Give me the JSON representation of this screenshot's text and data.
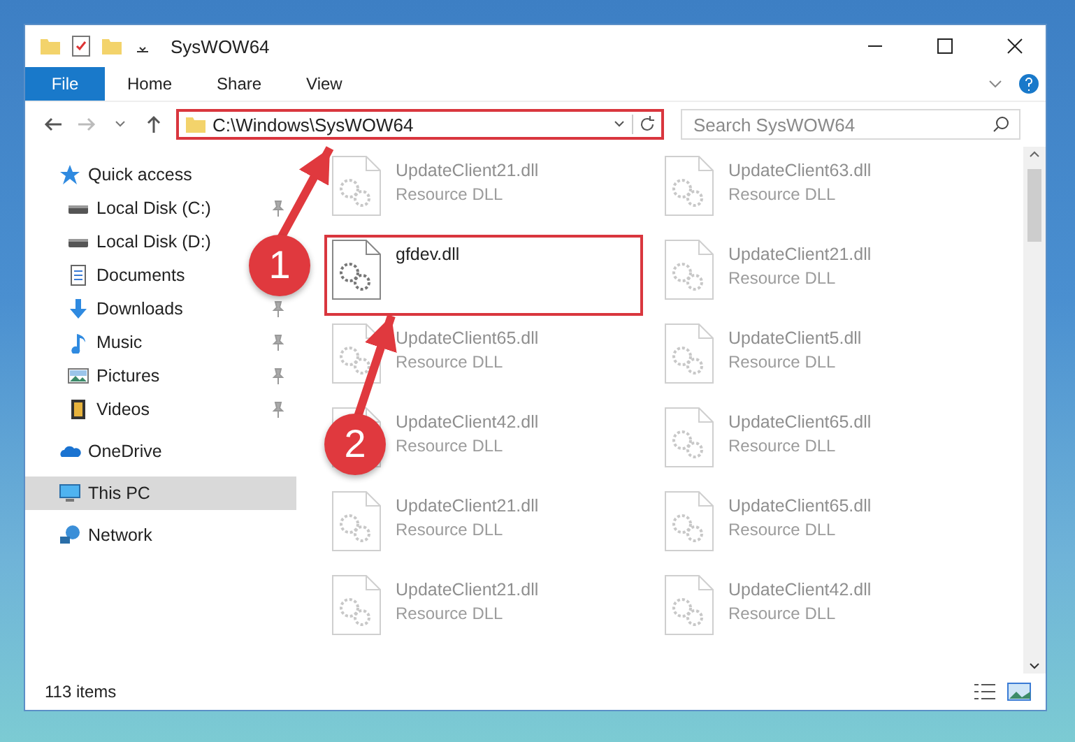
{
  "window": {
    "title": "SysWOW64"
  },
  "ribbon_tabs": [
    {
      "label": "File",
      "kind": "menu"
    },
    {
      "label": "Home",
      "kind": "tab"
    },
    {
      "label": "Share",
      "kind": "tab"
    },
    {
      "label": "View",
      "kind": "tab"
    }
  ],
  "address": {
    "path": "C:\\Windows\\SysWOW64"
  },
  "search": {
    "placeholder": "Search SysWOW64"
  },
  "navigation": [
    {
      "label": "Quick access",
      "selected": false,
      "children": [
        {
          "label": "Local Disk (C:)",
          "pinned": true,
          "selected": false
        },
        {
          "label": "Local Disk (D:)",
          "pinned": false,
          "selected": false
        },
        {
          "label": "Documents",
          "pinned": false,
          "selected": false
        },
        {
          "label": "Downloads",
          "pinned": true,
          "selected": false
        },
        {
          "label": "Music",
          "pinned": true,
          "selected": false
        },
        {
          "label": "Pictures",
          "pinned": true,
          "selected": false
        },
        {
          "label": "Videos",
          "pinned": true,
          "selected": false
        }
      ]
    },
    {
      "label": "OneDrive",
      "selected": false
    },
    {
      "label": "This PC",
      "selected": true
    },
    {
      "label": "Network",
      "selected": false
    }
  ],
  "files": [
    {
      "name": "UpdateClient21.dll",
      "type": "Resource DLL",
      "highlighted": false
    },
    {
      "name": "UpdateClient63.dll",
      "type": "Resource DLL",
      "highlighted": false
    },
    {
      "name": "gfdev.dll",
      "highlighted": true
    },
    {
      "name": "UpdateClient21.dll",
      "type": "Resource DLL",
      "highlighted": false
    },
    {
      "name": "UpdateClient65.dll",
      "type": "Resource DLL",
      "highlighted": false
    },
    {
      "name": "UpdateClient5.dll",
      "type": "Resource DLL",
      "highlighted": false
    },
    {
      "name": "UpdateClient42.dll",
      "type": "Resource DLL",
      "highlighted": false
    },
    {
      "name": "UpdateClient65.dll",
      "type": "Resource DLL",
      "highlighted": false
    },
    {
      "name": "UpdateClient21.dll",
      "type": "Resource DLL",
      "highlighted": false
    },
    {
      "name": "UpdateClient65.dll",
      "type": "Resource DLL",
      "highlighted": false
    },
    {
      "name": "UpdateClient21.dll",
      "type": "Resource DLL",
      "highlighted": false
    },
    {
      "name": "UpdateClient42.dll",
      "type": "Resource DLL",
      "highlighted": false
    }
  ],
  "status_bar": {
    "item_count": "113 items"
  },
  "annotations": [
    {
      "number": "1"
    },
    {
      "number": "2"
    }
  ]
}
